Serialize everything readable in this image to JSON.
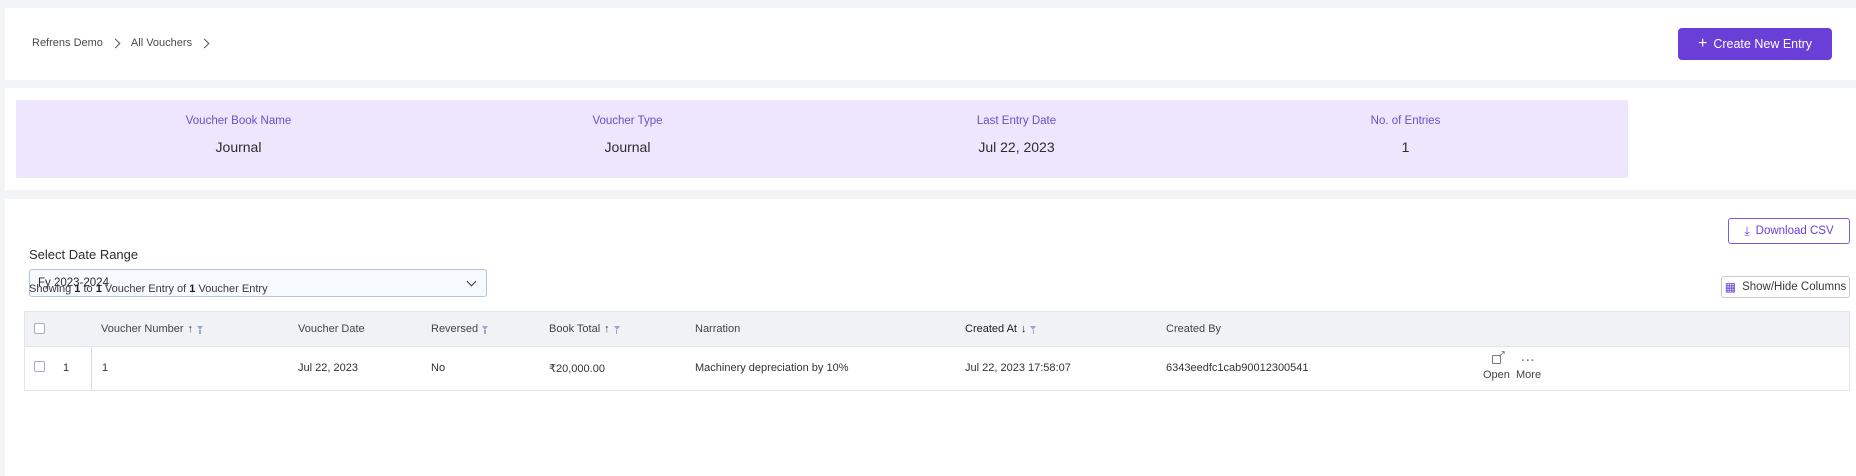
{
  "breadcrumb": [
    "Refrens Demo",
    "All Vouchers"
  ],
  "header": {
    "create_button": "Create New Entry"
  },
  "stats": [
    {
      "label": "Voucher Book Name",
      "value": "Journal"
    },
    {
      "label": "Voucher Type",
      "value": "Journal"
    },
    {
      "label": "Last Entry Date",
      "value": "Jul 22, 2023"
    },
    {
      "label": "No. of Entries",
      "value": "1"
    }
  ],
  "filters": {
    "date_range_label": "Select Date Range",
    "date_range_value": "Fy 2023-2024",
    "download_csv": "Download CSV",
    "show_hide_columns": "Show/Hide Columns"
  },
  "showing": {
    "prefix": "Showing",
    "from": "1",
    "to_word": "to",
    "to": "1",
    "mid": "Voucher Entry of",
    "total": "1",
    "suffix": "Voucher Entry"
  },
  "table": {
    "columns": [
      "Voucher Number",
      "Voucher Date",
      "Reversed",
      "Book Total",
      "Narration",
      "Created At",
      "Created By"
    ],
    "rows": [
      {
        "index": "1",
        "voucher_number": "1",
        "voucher_date": "Jul 22, 2023",
        "reversed": "No",
        "book_total": "₹20,000.00",
        "narration": "Machinery depreciation by 10%",
        "created_at": "Jul 22, 2023 17:58:07",
        "created_by": "6343eedfc1cab90012300541",
        "actions": [
          "Open",
          "More"
        ]
      }
    ]
  },
  "colors": {
    "primary": "#6a3fd8",
    "stat_bg": "#ede6fd",
    "stat_label": "#6b4fc8"
  }
}
